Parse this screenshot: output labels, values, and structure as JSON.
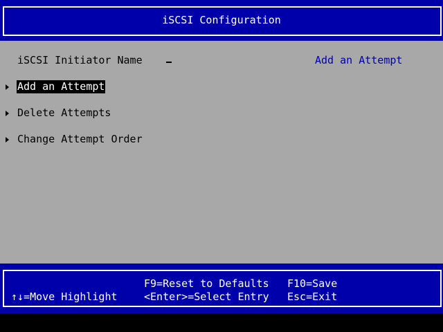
{
  "header": {
    "title": "iSCSI Configuration"
  },
  "form": {
    "initiator_name_label": "iSCSI Initiator Name",
    "initiator_name_value": "",
    "help_text": "Add an Attempt",
    "menu_items": [
      {
        "label": "Add an Attempt",
        "selected": true
      },
      {
        "label": "Delete Attempts",
        "selected": false
      },
      {
        "label": "Change Attempt Order",
        "selected": false
      }
    ]
  },
  "footer": {
    "move_highlight": "↑↓=Move Highlight",
    "reset_defaults": "F9=Reset to Defaults",
    "select_entry": "<Enter>=Select Entry",
    "save": "F10=Save",
    "exit": "Esc=Exit"
  },
  "colors": {
    "header_bg": "#0000aa",
    "body_bg": "#a8a8a8",
    "help_text": "#0000aa",
    "highlight_bg": "#000000",
    "highlight_fg": "#ffffff"
  }
}
